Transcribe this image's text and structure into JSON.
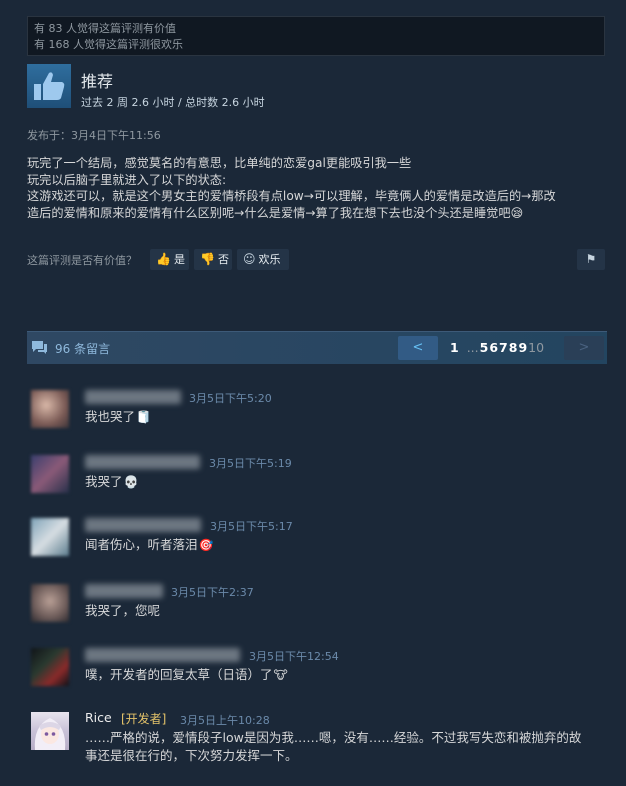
{
  "helpful": {
    "line1": "有 83 人觉得这篇评测有价值",
    "line2": "有 168 人觉得这篇评测很欢乐"
  },
  "verdict": {
    "title": "推荐",
    "hours": "过去 2 周 2.6 小时 / 总时数 2.6 小时",
    "icon": "thumbs-up-icon"
  },
  "posted": "发布于：3月4日下午11:56",
  "review": {
    "lines": [
      "玩完了一个结局，感觉莫名的有意思，比单纯的恋爱gal更能吸引我一些",
      "玩完以后脑子里就进入了以下的状态:",
      "这游戏还可以，就是这个男女主的爱情桥段有点low→可以理解，毕竟俩人的爱情是改造后的→那改",
      "造后的爱情和原来的爱情有什么区别呢→什么是爱情→算了我在想下去也没个头还是睡觉吧😪"
    ]
  },
  "vote": {
    "question": "这篇评测是否有价值？",
    "yes": "是",
    "no": "否",
    "funny": "欢乐"
  },
  "comments_header": {
    "count": "96 条留言",
    "prev": "<",
    "next": ">",
    "current_page": "1",
    "ellipsis": "...",
    "pages": [
      "5",
      "6",
      "7",
      "8",
      "9"
    ],
    "last": "10"
  },
  "comments": [
    {
      "time": "3月5日下午5:20",
      "text": "我也哭了",
      "emoji": "🧻"
    },
    {
      "time": "3月5日下午5:19",
      "text": "我哭了",
      "emoji": "💀"
    },
    {
      "time": "3月5日下午5:17",
      "text": "闻者伤心，听者落泪",
      "emoji": "🎯"
    },
    {
      "time": "3月5日下午2:37",
      "text": "我哭了，您呢",
      "emoji": ""
    },
    {
      "time": "3月5日下午12:54",
      "text": "噗，开发者的回复太草（日语）了",
      "emoji": "🐮"
    },
    {
      "author": "Rice",
      "dev_tag": "[开发者]",
      "time": "3月5日上午10:28",
      "text_lines": [
        "……严格的说，爱情段子low是因为我……嗯，没有……经验。不过我写失恋和被抛弃的故",
        "事还是很在行的，下次努力发挥一下。"
      ]
    }
  ],
  "colors": {
    "background": "#1b2838",
    "accent": "#66c0f4",
    "dev_tag": "#e5c46a"
  }
}
